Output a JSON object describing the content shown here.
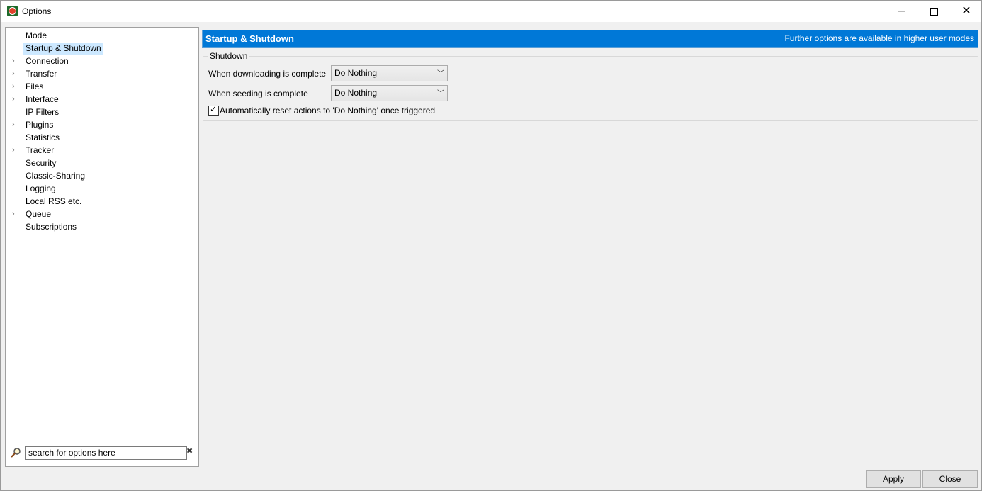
{
  "window": {
    "title": "Options"
  },
  "sidebar": {
    "items": [
      {
        "label": "Mode",
        "expandable": false,
        "selected": false
      },
      {
        "label": "Startup & Shutdown",
        "expandable": false,
        "selected": true
      },
      {
        "label": "Connection",
        "expandable": true,
        "selected": false
      },
      {
        "label": "Transfer",
        "expandable": true,
        "selected": false
      },
      {
        "label": "Files",
        "expandable": true,
        "selected": false
      },
      {
        "label": "Interface",
        "expandable": true,
        "selected": false
      },
      {
        "label": "IP Filters",
        "expandable": false,
        "selected": false
      },
      {
        "label": "Plugins",
        "expandable": true,
        "selected": false
      },
      {
        "label": "Statistics",
        "expandable": false,
        "selected": false
      },
      {
        "label": "Tracker",
        "expandable": true,
        "selected": false
      },
      {
        "label": "Security",
        "expandable": false,
        "selected": false
      },
      {
        "label": "Classic-Sharing",
        "expandable": false,
        "selected": false
      },
      {
        "label": "Logging",
        "expandable": false,
        "selected": false
      },
      {
        "label": "Local RSS etc.",
        "expandable": false,
        "selected": false
      },
      {
        "label": "Queue",
        "expandable": true,
        "selected": false
      },
      {
        "label": "Subscriptions",
        "expandable": false,
        "selected": false
      }
    ],
    "search": {
      "value": "search for options here"
    }
  },
  "main": {
    "header": {
      "title": "Startup & Shutdown",
      "note": "Further options are available in higher user modes",
      "color": "#0078d7"
    },
    "shutdown_group": {
      "title": "Shutdown",
      "downloading_label": "When downloading is complete",
      "downloading_value": "Do Nothing",
      "seeding_label": "When seeding is complete",
      "seeding_value": "Do Nothing",
      "auto_reset_label": "Automatically reset actions to 'Do Nothing' once triggered",
      "auto_reset_checked": true
    }
  },
  "buttons": {
    "apply": "Apply",
    "close": "Close"
  },
  "icons": {
    "expand": "chevron-right-icon",
    "search": "magnifier-icon",
    "clear": "clear-icon"
  }
}
